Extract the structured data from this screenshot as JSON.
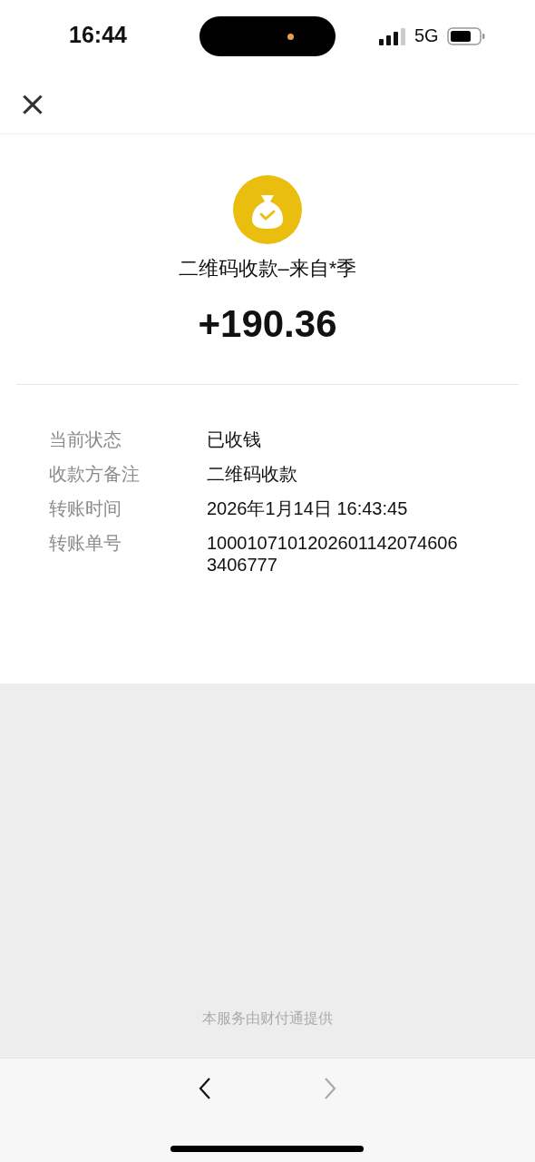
{
  "status_bar": {
    "time": "16:44",
    "network": "5G"
  },
  "header": {
    "close": "×"
  },
  "summary": {
    "title": "二维码收款–来自*季",
    "amount": "+190.36"
  },
  "details": [
    {
      "label": "当前状态",
      "value": "已收钱"
    },
    {
      "label": "收款方备注",
      "value": "二维码收款"
    },
    {
      "label": "转账时间",
      "value": "2026年1月14日 16:43:45"
    },
    {
      "label": "转账单号",
      "value": "10001071012026011420746063406777"
    }
  ],
  "footer": {
    "text": "本服务由财付通提供"
  },
  "nav": [
    {
      "kind": "back",
      "disabled": false
    },
    {
      "kind": "forward",
      "disabled": true
    }
  ]
}
